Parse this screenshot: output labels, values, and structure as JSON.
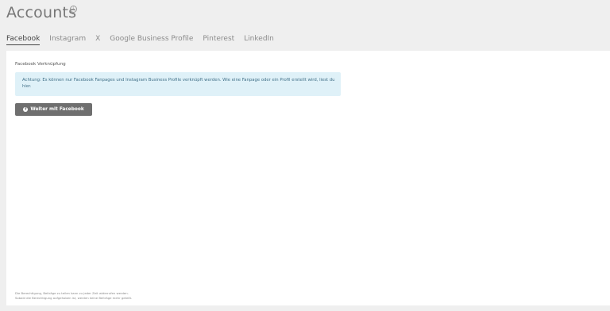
{
  "header": {
    "title": "Accounts",
    "info_icon": "info-icon"
  },
  "tabs": [
    {
      "label": "Facebook",
      "active": true
    },
    {
      "label": "Instagram",
      "active": false
    },
    {
      "label": "X",
      "active": false
    },
    {
      "label": "Google Business Profile",
      "active": false
    },
    {
      "label": "Pinterest",
      "active": false
    },
    {
      "label": "LinkedIn",
      "active": false
    }
  ],
  "panel": {
    "section_label": "Facebook Verknüpfung",
    "alert_text": "Achtung: Es können nur Facebook Fanpages und Instagram Business Profile verknüpft werden. Wie eine Fanpage oder ein Profil erstellt wird, liest du hier.",
    "button_label": "Weiter mit Facebook",
    "button_icon": "facebook-icon",
    "footer_line1": "Die Berechtigung, Beiträge zu teilen kann zu jeder Zeit widerrufen werden.",
    "footer_line2": "Sobald die Berechtigung aufgehoben ist, werden keine Beiträge mehr geteilt."
  },
  "colors": {
    "background": "#efefef",
    "panel": "#ffffff",
    "alert_bg": "#dff1f8",
    "alert_text": "#3f6e86",
    "button_bg": "#6f6f6f"
  }
}
